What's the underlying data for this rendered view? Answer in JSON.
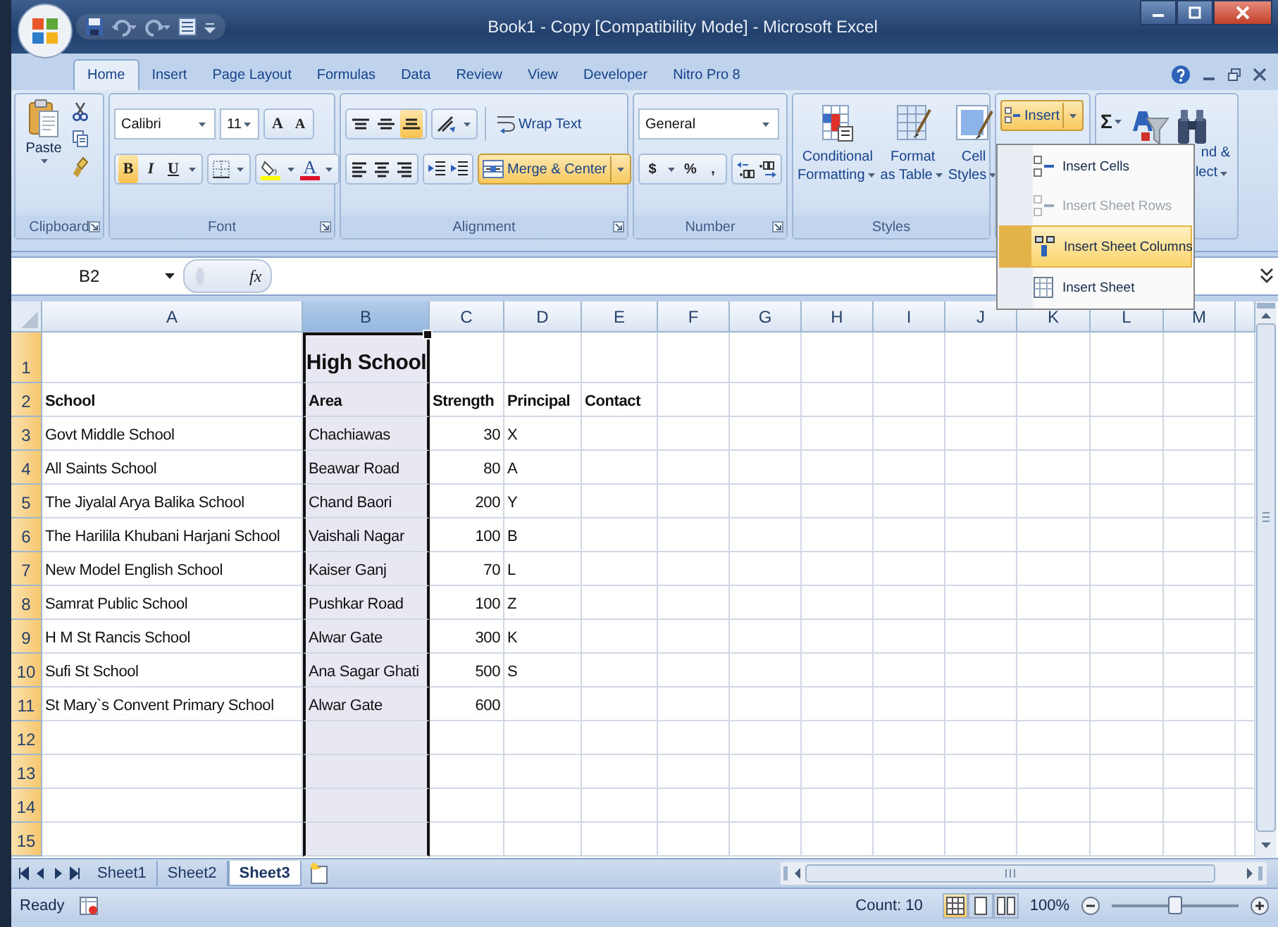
{
  "window": {
    "title": "Book1 - Copy  [Compatibility Mode] - Microsoft Excel"
  },
  "tabs": [
    {
      "label": "Home",
      "selected": true
    },
    {
      "label": "Insert",
      "selected": false
    },
    {
      "label": "Page Layout",
      "selected": false
    },
    {
      "label": "Formulas",
      "selected": false
    },
    {
      "label": "Data",
      "selected": false
    },
    {
      "label": "Review",
      "selected": false
    },
    {
      "label": "View",
      "selected": false
    },
    {
      "label": "Developer",
      "selected": false
    },
    {
      "label": "Nitro Pro 8",
      "selected": false
    }
  ],
  "ribbon": {
    "clipboard": {
      "paste": "Paste",
      "label": "Clipboard"
    },
    "font": {
      "name": "Calibri",
      "size": "11",
      "grow": "A",
      "shrink": "A",
      "styles": [
        {
          "label": "B",
          "selected": true
        },
        {
          "label": "I",
          "selected": false
        },
        {
          "label": "U",
          "selected": false
        }
      ],
      "color_letter": "A",
      "label": "Font"
    },
    "alignment": {
      "vertical": [
        {
          "kind": "top",
          "selected": false
        },
        {
          "kind": "middle",
          "selected": false
        },
        {
          "kind": "bottom",
          "selected": true
        }
      ],
      "wrap": "Wrap Text",
      "merge": {
        "label": "Merge & Center",
        "selected": true
      },
      "label": "Alignment"
    },
    "number": {
      "format": "General",
      "symbols": [
        "$",
        "%",
        ","
      ],
      "label": "Number"
    },
    "styles": {
      "buttons": [
        {
          "kind": "conditional",
          "lines": [
            "Conditional",
            "Formatting"
          ]
        },
        {
          "kind": "table",
          "lines": [
            "Format",
            "as Table"
          ]
        },
        {
          "kind": "cell",
          "lines": [
            "Cell",
            "Styles"
          ]
        }
      ],
      "label": "Styles"
    },
    "cells": {
      "insert": {
        "label": "Insert",
        "selected": true
      }
    },
    "editing": {
      "sum": "Σ",
      "find_lines": [
        "nd &",
        "lect"
      ]
    }
  },
  "insert_menu": [
    {
      "kind": "cells",
      "label": "Insert Cells",
      "disabled": false,
      "selected": false
    },
    {
      "kind": "rows",
      "label": "Insert Sheet Rows",
      "disabled": true,
      "selected": false
    },
    {
      "kind": "columns",
      "label": "Insert Sheet Columns",
      "disabled": false,
      "selected": true
    },
    {
      "kind": "sheet",
      "label": "Insert Sheet",
      "disabled": false,
      "selected": false
    }
  ],
  "formula_bar": {
    "name_box": "B2",
    "fx": "fx"
  },
  "columns": [
    {
      "label": "A",
      "selected": false
    },
    {
      "label": "B",
      "selected": true
    },
    {
      "label": "C",
      "selected": false
    },
    {
      "label": "D",
      "selected": false
    },
    {
      "label": "E",
      "selected": false
    },
    {
      "label": "F",
      "selected": false
    },
    {
      "label": "G",
      "selected": false
    },
    {
      "label": "H",
      "selected": false
    },
    {
      "label": "I",
      "selected": false
    },
    {
      "label": "J",
      "selected": false
    },
    {
      "label": "K",
      "selected": false
    },
    {
      "label": "L",
      "selected": false
    },
    {
      "label": "M",
      "selected": false
    }
  ],
  "rows": [
    {
      "number": "1",
      "kind": "title",
      "selected": true,
      "title": "High School"
    },
    {
      "number": "2",
      "kind": "header",
      "selected": true,
      "cells": [
        "School",
        "Area",
        "Strength",
        "Principal",
        "Contact"
      ]
    },
    {
      "number": "3",
      "kind": "data",
      "selected": true,
      "cells": [
        "Govt Middle School",
        "Chachiawas",
        "30",
        "X"
      ]
    },
    {
      "number": "4",
      "kind": "data",
      "selected": true,
      "cells": [
        "All Saints School",
        "Beawar Road",
        "80",
        "A"
      ]
    },
    {
      "number": "5",
      "kind": "data",
      "selected": true,
      "cells": [
        "The Jiyalal Arya Balika School",
        "Chand Baori",
        "200",
        "Y"
      ]
    },
    {
      "number": "6",
      "kind": "data",
      "selected": true,
      "cells": [
        "The Harilila Khubani Harjani School",
        "Vaishali Nagar",
        "100",
        "B"
      ]
    },
    {
      "number": "7",
      "kind": "data",
      "selected": true,
      "cells": [
        "New Model English School",
        "Kaiser Ganj",
        "70",
        "L"
      ]
    },
    {
      "number": "8",
      "kind": "data",
      "selected": true,
      "cells": [
        "Samrat Public School",
        "Pushkar Road",
        "100",
        "Z"
      ]
    },
    {
      "number": "9",
      "kind": "data",
      "selected": true,
      "cells": [
        "H M St Rancis School",
        "Alwar Gate",
        "300",
        "K"
      ]
    },
    {
      "number": "10",
      "kind": "data",
      "selected": true,
      "cells": [
        "Sufi St School",
        "Ana Sagar Ghati",
        "500",
        "S"
      ]
    },
    {
      "number": "11",
      "kind": "data",
      "selected": true,
      "cells": [
        "St Mary`s Convent Primary School",
        "Alwar Gate",
        "600"
      ]
    },
    {
      "number": "12",
      "kind": "empty",
      "selected": true
    },
    {
      "number": "13",
      "kind": "empty",
      "selected": true
    },
    {
      "number": "14",
      "kind": "empty",
      "selected": true
    },
    {
      "number": "15",
      "kind": "empty",
      "selected": true
    }
  ],
  "sheets": [
    {
      "label": "Sheet1",
      "selected": false
    },
    {
      "label": "Sheet2",
      "selected": false
    },
    {
      "label": "Sheet3",
      "selected": true
    }
  ],
  "status_bar": {
    "mode": "Ready",
    "count": "Count: 10",
    "views": [
      {
        "kind": "normal",
        "selected": true
      },
      {
        "kind": "layout",
        "selected": false
      },
      {
        "kind": "break",
        "selected": false
      }
    ],
    "zoom": "100%",
    "zoom_slider": {
      "level": 0.5
    }
  }
}
